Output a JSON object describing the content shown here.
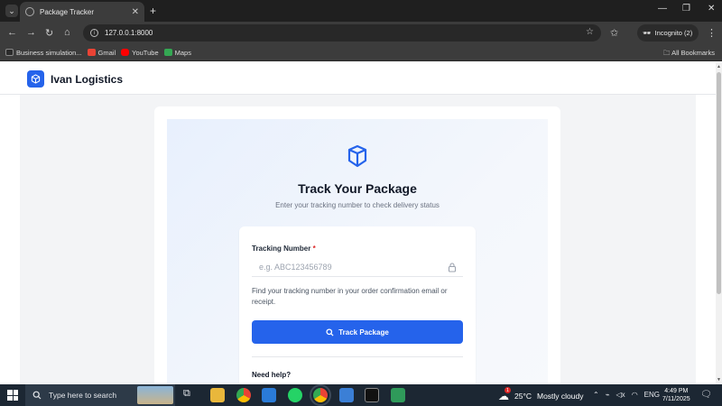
{
  "browser": {
    "tab_title": "Package Tracker",
    "url": "127.0.0.1:8000",
    "incognito_label": "Incognito (2)",
    "bookmarks": [
      {
        "label": "Business simulation...",
        "icon": "sc-icon",
        "color": "#2b2b2b"
      },
      {
        "label": "Gmail",
        "icon": "gmail-icon",
        "color": "#ea4335"
      },
      {
        "label": "YouTube",
        "icon": "youtube-icon",
        "color": "#ff0000"
      },
      {
        "label": "Maps",
        "icon": "maps-icon",
        "color": "#34a853"
      }
    ],
    "all_bookmarks": "All Bookmarks"
  },
  "header": {
    "brand": "Ivan Logistics",
    "brand_color": "#2563eb"
  },
  "tracker": {
    "title": "Track Your Package",
    "subtitle": "Enter your tracking number to check delivery status",
    "field_label": "Tracking Number",
    "required_mark": "*",
    "placeholder": "e.g. ABC123456789",
    "value": "",
    "help_text": "Find your tracking number in your order confirmation email or receipt.",
    "button_label": "Track Package",
    "need_help": "Need help?"
  },
  "taskbar": {
    "search_placeholder": "Type here to search",
    "weather_temp": "25°C",
    "weather_desc": "Mostly cloudy",
    "weather_badge": "1",
    "language": "ENG",
    "time": "4:49 PM",
    "date": "7/11/2025"
  }
}
